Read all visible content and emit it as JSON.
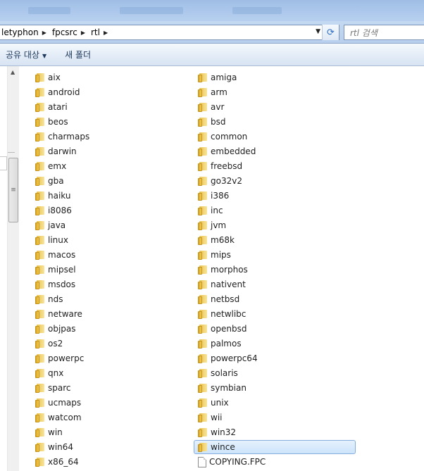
{
  "address": {
    "crumbs": [
      "letyphon",
      "fpcsrc",
      "rtl"
    ],
    "search_placeholder": "rtl 검색"
  },
  "toolbar": {
    "share_label": "공유 대상",
    "new_folder_label": "새 폴더"
  },
  "files": {
    "left": [
      {
        "name": "aix",
        "type": "folder"
      },
      {
        "name": "android",
        "type": "folder"
      },
      {
        "name": "atari",
        "type": "folder"
      },
      {
        "name": "beos",
        "type": "folder"
      },
      {
        "name": "charmaps",
        "type": "folder"
      },
      {
        "name": "darwin",
        "type": "folder"
      },
      {
        "name": "emx",
        "type": "folder"
      },
      {
        "name": "gba",
        "type": "folder"
      },
      {
        "name": "haiku",
        "type": "folder"
      },
      {
        "name": "i8086",
        "type": "folder"
      },
      {
        "name": "java",
        "type": "folder"
      },
      {
        "name": "linux",
        "type": "folder"
      },
      {
        "name": "macos",
        "type": "folder"
      },
      {
        "name": "mipsel",
        "type": "folder"
      },
      {
        "name": "msdos",
        "type": "folder"
      },
      {
        "name": "nds",
        "type": "folder"
      },
      {
        "name": "netware",
        "type": "folder"
      },
      {
        "name": "objpas",
        "type": "folder"
      },
      {
        "name": "os2",
        "type": "folder"
      },
      {
        "name": "powerpc",
        "type": "folder"
      },
      {
        "name": "qnx",
        "type": "folder"
      },
      {
        "name": "sparc",
        "type": "folder"
      },
      {
        "name": "ucmaps",
        "type": "folder"
      },
      {
        "name": "watcom",
        "type": "folder"
      },
      {
        "name": "win",
        "type": "folder"
      },
      {
        "name": "win64",
        "type": "folder"
      },
      {
        "name": "x86_64",
        "type": "folder"
      }
    ],
    "right": [
      {
        "name": "amiga",
        "type": "folder"
      },
      {
        "name": "arm",
        "type": "folder"
      },
      {
        "name": "avr",
        "type": "folder"
      },
      {
        "name": "bsd",
        "type": "folder"
      },
      {
        "name": "common",
        "type": "folder"
      },
      {
        "name": "embedded",
        "type": "folder"
      },
      {
        "name": "freebsd",
        "type": "folder"
      },
      {
        "name": "go32v2",
        "type": "folder"
      },
      {
        "name": "i386",
        "type": "folder"
      },
      {
        "name": "inc",
        "type": "folder"
      },
      {
        "name": "jvm",
        "type": "folder"
      },
      {
        "name": "m68k",
        "type": "folder"
      },
      {
        "name": "mips",
        "type": "folder"
      },
      {
        "name": "morphos",
        "type": "folder"
      },
      {
        "name": "nativent",
        "type": "folder"
      },
      {
        "name": "netbsd",
        "type": "folder"
      },
      {
        "name": "netwlibc",
        "type": "folder"
      },
      {
        "name": "openbsd",
        "type": "folder"
      },
      {
        "name": "palmos",
        "type": "folder"
      },
      {
        "name": "powerpc64",
        "type": "folder"
      },
      {
        "name": "solaris",
        "type": "folder"
      },
      {
        "name": "symbian",
        "type": "folder"
      },
      {
        "name": "unix",
        "type": "folder"
      },
      {
        "name": "wii",
        "type": "folder"
      },
      {
        "name": "win32",
        "type": "folder"
      },
      {
        "name": "wince",
        "type": "folder",
        "selected": true
      },
      {
        "name": "COPYING.FPC",
        "type": "file"
      }
    ]
  },
  "colors": {
    "selection_border": "#84acdd",
    "selection_fill": "#cde4fb",
    "folder": "#f3cd55"
  }
}
